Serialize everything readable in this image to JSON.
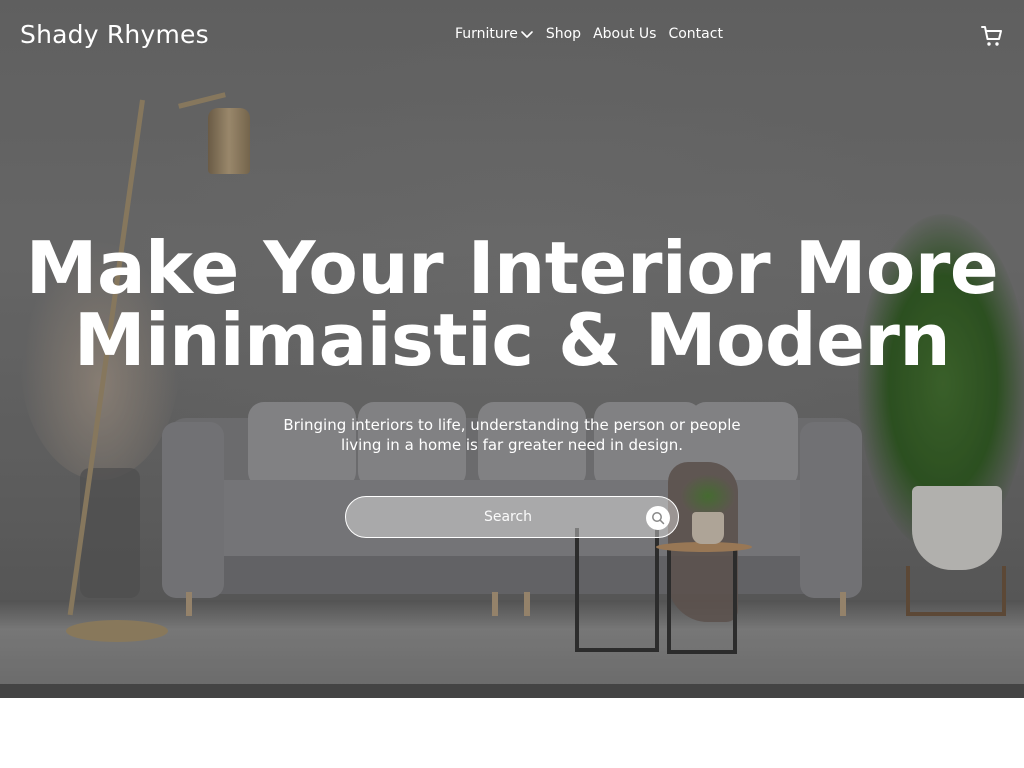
{
  "brand": {
    "name": "Shady Rhymes"
  },
  "nav": {
    "items": [
      {
        "label": "Furniture",
        "has_dropdown": true
      },
      {
        "label": "Shop"
      },
      {
        "label": "About Us"
      },
      {
        "label": "Contact"
      }
    ]
  },
  "header": {
    "cart_icon": "cart-icon"
  },
  "hero": {
    "headline_line1": "Make Your Interior More",
    "headline_line2": "Minimaistic & Modern",
    "subtitle": "Bringing interiors to life, understanding the person or people living in a home is far greater need in design.",
    "search": {
      "placeholder": "Search",
      "icon": "search-icon"
    }
  },
  "colors": {
    "text": "#ffffff",
    "background": "#ffffff"
  }
}
